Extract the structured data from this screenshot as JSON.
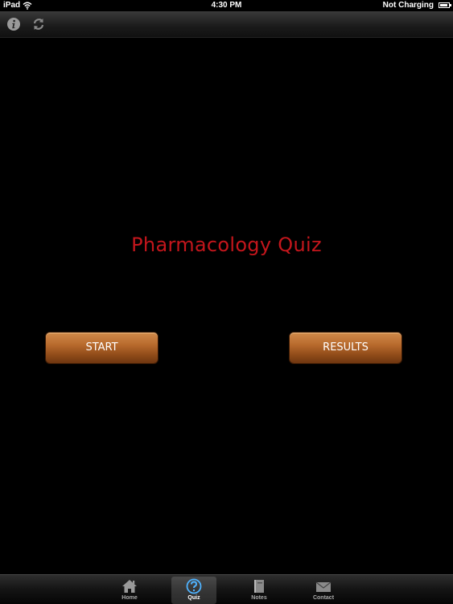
{
  "statusbar": {
    "device": "iPad",
    "time": "4:30 PM",
    "charging": "Not Charging",
    "battery_level": 0.9
  },
  "toolbar": {
    "info_icon": "info-icon",
    "refresh_icon": "refresh-icon"
  },
  "main": {
    "title": "Pharmacology Quiz",
    "title_color": "#c4161c",
    "start_label": "START",
    "results_label": "RESULTS"
  },
  "tabbar": {
    "tabs": [
      {
        "label": "Home",
        "icon": "home-icon"
      },
      {
        "label": "Quiz",
        "icon": "question-icon",
        "selected": true
      },
      {
        "label": "Notes",
        "icon": "book-icon"
      },
      {
        "label": "Contact",
        "icon": "envelope-icon"
      }
    ]
  }
}
